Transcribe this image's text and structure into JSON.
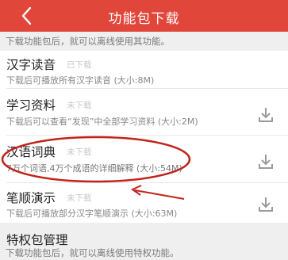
{
  "header": {
    "title": "功能包下载",
    "background_color": "#e0463a"
  },
  "notice_top": "下载功能包后，就可以离线使用其功能。",
  "packages": [
    {
      "title": "汉字读音",
      "status": "已下载",
      "desc": "下载后可播放所有汉字读音 (大小:8M)",
      "icon": "none"
    },
    {
      "title": "学习资料",
      "status": "未下载",
      "desc": "下载后可以查看“发现”中全部学习资料 (大小:2M)",
      "icon": "download-icon"
    },
    {
      "title": "汉语词典",
      "status": "未下载",
      "desc": "7万个词语,4万个成语的详细解释 (大小:54M)",
      "icon": "download-icon"
    },
    {
      "title": "笔顺演示",
      "status": "未下载",
      "desc": "下载后可播放部分汉字笔顺演示 (大小:63M)",
      "icon": "download-icon"
    }
  ],
  "privilege_section": {
    "title": "特权包管理",
    "notice": "下载功能包后，就可以离线使用特权功能。"
  },
  "annotation": {
    "color": "#c0231a",
    "target": "汉语词典"
  }
}
